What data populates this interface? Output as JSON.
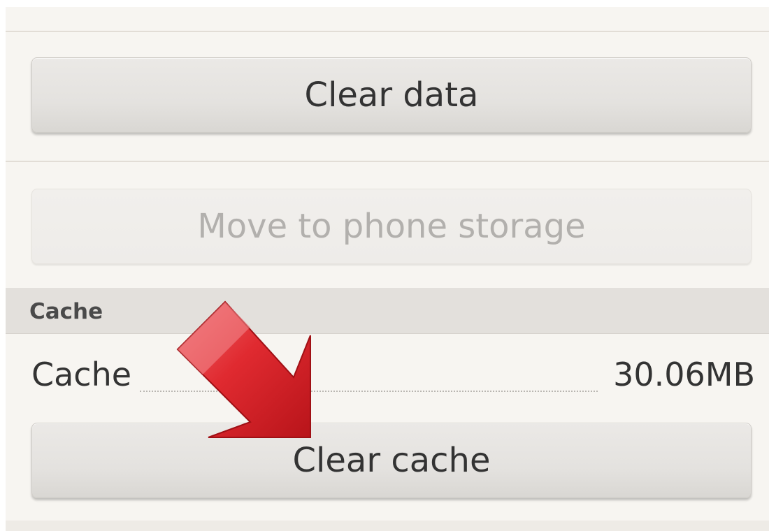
{
  "app_info": {
    "storage": {
      "clear_data_label": "Clear data",
      "move_storage_label": "Move to phone storage"
    },
    "cache": {
      "section_title": "Cache",
      "row_label": "Cache",
      "row_value": "30.06MB",
      "clear_cache_label": "Clear cache"
    }
  },
  "annotation": {
    "arrow_color": "#d62027",
    "arrow_target": "clear-cache-button"
  }
}
